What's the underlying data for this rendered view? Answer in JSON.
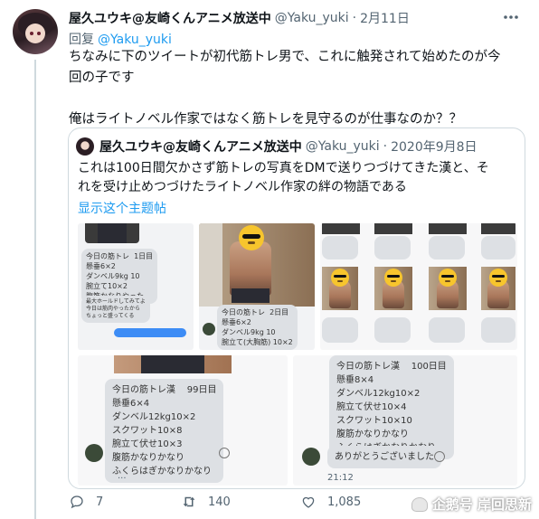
{
  "tweet": {
    "display_name": "屋久ユウキ@友崎くんアニメ放送中",
    "handle": "@Yaku_yuki",
    "separator": "·",
    "date": "2月11日",
    "reply_prefix": "回复",
    "reply_to": "@Yaku_yuki",
    "text_line1": "ちなみに下のツイートが初代筋トレ男で、これに触発されて始めたのが今",
    "text_line2": "回の子です",
    "text_line3": "俺はライトノベル作家ではなく筋トレを見守るのが仕事なのか？？"
  },
  "quote": {
    "display_name": "屋久ユウキ@友崎くんアニメ放送中",
    "handle": "@Yaku_yuki",
    "separator": "·",
    "date": "2020年9月8日",
    "text_line1": "これは100日間欠かさず筋トレの写真をDMで送りつづけてきた漢と、そ",
    "text_line2": "れを受け止めつづけたライトノベル作家の絆の物語である",
    "show_thread": "显示这个主题帖",
    "media": {
      "day1_bubble": "今日の筋トレ  1日目\n懸垂6×2\nダンベル9kg 10\n腕立て10×2\n腹筋かなりやった",
      "day1_reply": "最大ホールドしてみてよ\n今日は筋肉やったから\nちょっと盛ってくる",
      "day2_bubble": "今日の筋トレ  2日目\n懸垂6×2\nダンベル9kg 10\n腕立て(大胸筋) 10×2",
      "day99_bubble": "今日の筋トレ漢    99日目\n懸垂6×4\nダンベル12kg10×2\nスクワット10×8\n腕立て伏せ10×3\n腹筋かなりかなり\nふくらはぎかなりかなり",
      "day99_more": "...",
      "day100_bubble": "今日の筋トレ漢    100日目\n懸垂8×4\nダンベル12kg10×2\n腕立て伏せ10×4\nスクワット10×10\n腹筋かなりかなり\nふくらはぎかなりかなり",
      "day100_thanks": "ありがとうございました",
      "day100_time": "21:12"
    }
  },
  "actions": {
    "reply_count": "7",
    "retweet_count": "140",
    "like_count": "1,085"
  },
  "watermark": "企鹅号 岸回思新",
  "icons": {
    "more": "more-horizontal-icon",
    "reply": "reply-icon",
    "retweet": "retweet-icon",
    "like": "heart-icon"
  },
  "colors": {
    "link": "#1d9bf0",
    "secondary_text": "#536471",
    "border": "#cfd9de"
  }
}
